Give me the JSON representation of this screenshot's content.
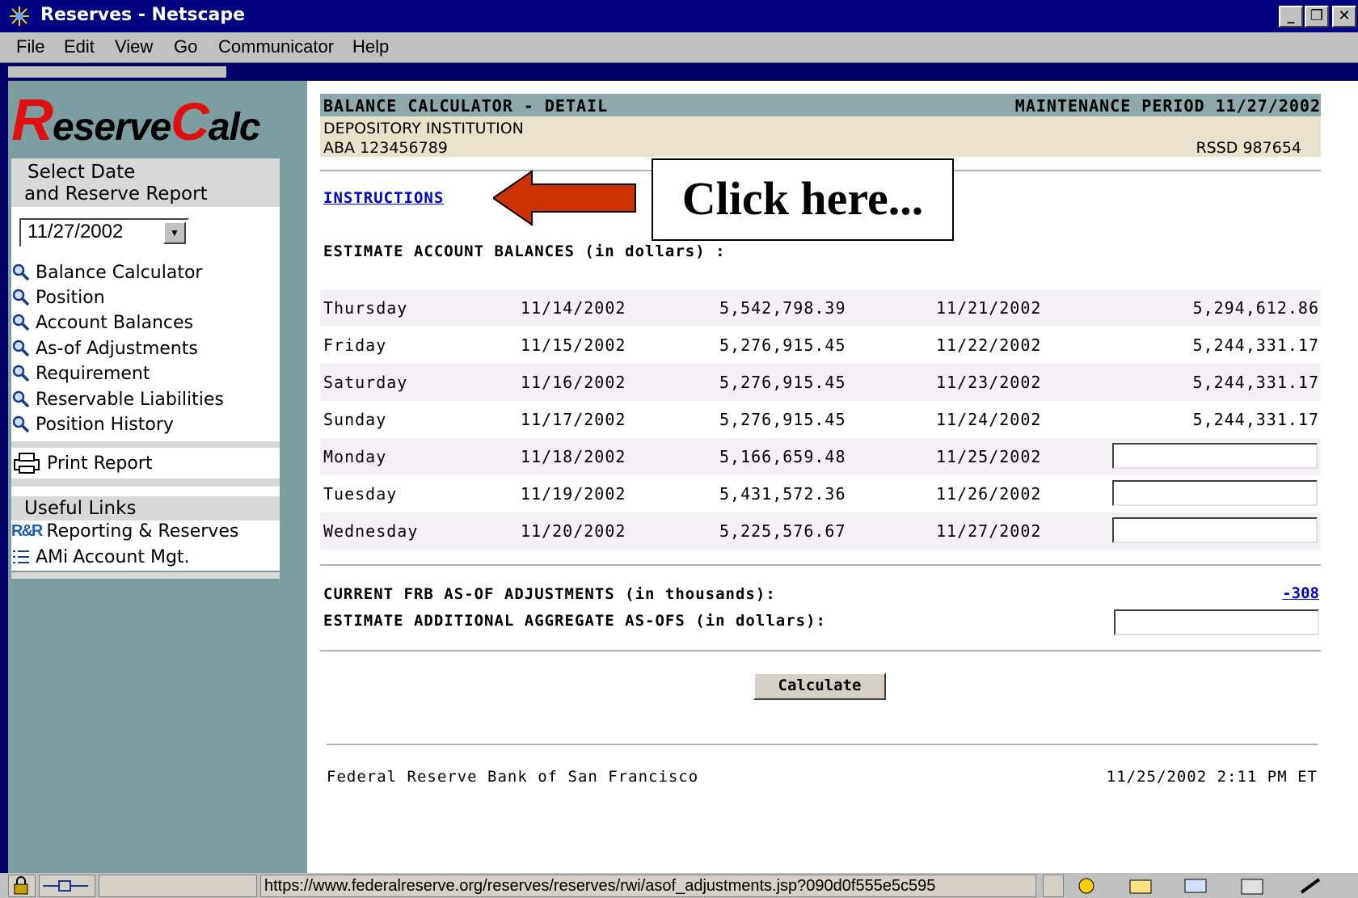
{
  "window": {
    "title": "Reserves - Netscape",
    "buttons": {
      "minimize": "_",
      "maximize": "❐",
      "close": "✕"
    }
  },
  "menu": [
    "File",
    "Edit",
    "View",
    "Go",
    "Communicator",
    "Help"
  ],
  "sidebar": {
    "logo": {
      "part1_cap": "R",
      "part1": "eserve",
      "part2_cap": "C",
      "part2": "alc"
    },
    "select_header_line1": "Select Date",
    "select_header_line2": "and Reserve Report",
    "date_value": "11/27/2002",
    "nav_items": [
      "Balance Calculator",
      "Position",
      "Account Balances",
      "As-of Adjustments",
      "Requirement",
      "Reservable Liabilities",
      "Position History"
    ],
    "print_label": "Print Report",
    "useful_links_header": "Useful Links",
    "links": [
      {
        "badge": "R&R",
        "label": "Reporting & Reserves"
      },
      {
        "badge": "AMi",
        "label": "Account Mgt."
      }
    ]
  },
  "main": {
    "header_title": "BALANCE CALCULATOR - DETAIL",
    "header_period": "MAINTENANCE PERIOD 11/27/2002",
    "institution_label": "DEPOSITORY INSTITUTION",
    "aba": "ABA 123456789",
    "rssd": "RSSD 987654",
    "instructions_link": "INSTRUCTIONS",
    "callout_text": "Click here...",
    "estimate_label": "ESTIMATE ACCOUNT BALANCES (in dollars) :",
    "rows": [
      {
        "day": "Thursday",
        "date1": "11/14/2002",
        "value1": "5,542,798.39",
        "date2": "11/21/2002",
        "value2": "5,294,612.86"
      },
      {
        "day": "Friday",
        "date1": "11/15/2002",
        "value1": "5,276,915.45",
        "date2": "11/22/2002",
        "value2": "5,244,331.17"
      },
      {
        "day": "Saturday",
        "date1": "11/16/2002",
        "value1": "5,276,915.45",
        "date2": "11/23/2002",
        "value2": "5,244,331.17"
      },
      {
        "day": "Sunday",
        "date1": "11/17/2002",
        "value1": "5,276,915.45",
        "date2": "11/24/2002",
        "value2": "5,244,331.17"
      },
      {
        "day": "Monday",
        "date1": "11/18/2002",
        "value1": "5,166,659.48",
        "date2": "11/25/2002",
        "value2": ""
      },
      {
        "day": "Tuesday",
        "date1": "11/19/2002",
        "value1": "5,431,572.36",
        "date2": "11/26/2002",
        "value2": ""
      },
      {
        "day": "Wednesday",
        "date1": "11/20/2002",
        "value1": "5,225,576.67",
        "date2": "11/27/2002",
        "value2": ""
      }
    ],
    "frb_adjustments_label": "CURRENT FRB AS-OF ADJUSTMENTS (in thousands):",
    "frb_adjustments_value": "-308",
    "aggregate_label": "ESTIMATE ADDITIONAL AGGREGATE AS-OFS (in dollars):",
    "calculate_button": "Calculate",
    "footer_org": "Federal Reserve Bank of San Francisco",
    "footer_timestamp": "11/25/2002 2:11 PM ET"
  },
  "status": {
    "url": "https://www.federalreserve.org/reserves/reserves/rwi/asof_adjustments.jsp?090d0f555e5c595"
  },
  "colors": {
    "accent_red": "#e01010",
    "link_blue": "#0000cc",
    "sidebar_bg": "#7c9ea0",
    "callout_arrow": "#cc3300"
  }
}
